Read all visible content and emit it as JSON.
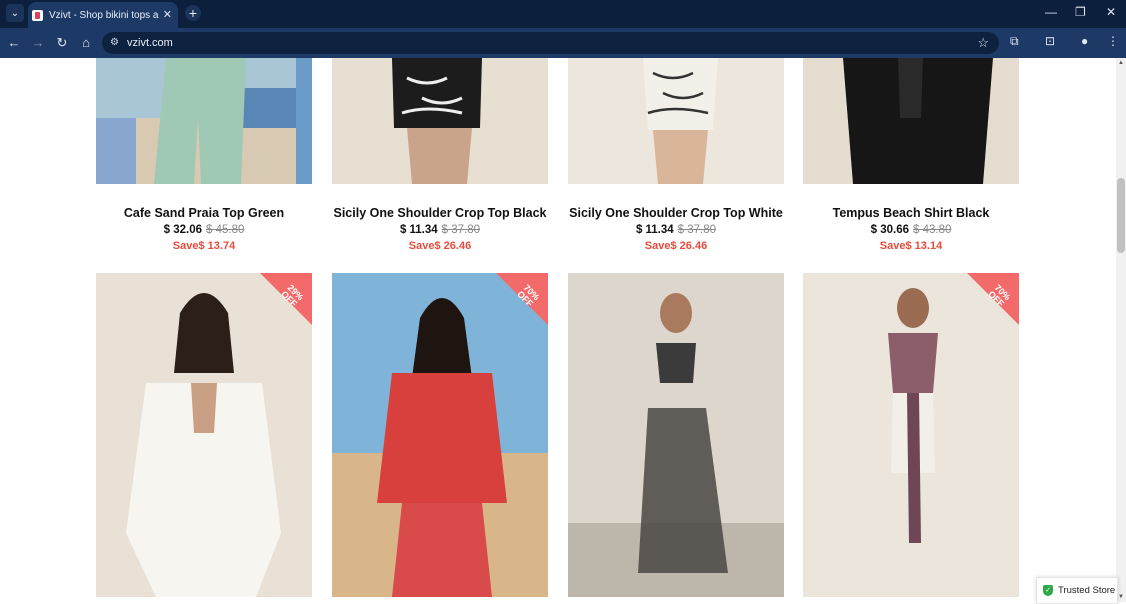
{
  "browser": {
    "tab_title": "Vzivt - Shop bikini tops and bo",
    "url": "vzivt.com",
    "tab_close": "✕",
    "new_tab": "+",
    "minimize": "—",
    "restore": "❐",
    "close": "✕"
  },
  "products_top": [
    {
      "title": "Cafe Sand Praia Top Green",
      "price": "$ 32.06",
      "old_price": "$ 45.80",
      "save": "Save$ 13.74"
    },
    {
      "title": "Sicily One Shoulder Crop Top Black",
      "price": "$ 11.34",
      "old_price": "$ 37.80",
      "save": "Save$ 26.46"
    },
    {
      "title": "Sicily One Shoulder Crop Top White",
      "price": "$ 11.34",
      "old_price": "$ 37.80",
      "save": "Save$ 26.46"
    },
    {
      "title": "Tempus Beach Shirt Black",
      "price": "$ 30.66",
      "old_price": "$ 43.80",
      "save": "Save$ 13.14"
    }
  ],
  "products_bottom": [
    {
      "badge": "29%\nOFF"
    },
    {
      "badge": "70%\nOFF"
    },
    {
      "badge": ""
    },
    {
      "badge": "70%\nOFF"
    }
  ],
  "trusted_store": "Trusted Store",
  "colors": {
    "sale": "#e74c3c",
    "badge": "#f26a6a",
    "chrome_dark": "#0c1f3d",
    "chrome": "#1d3a66"
  }
}
